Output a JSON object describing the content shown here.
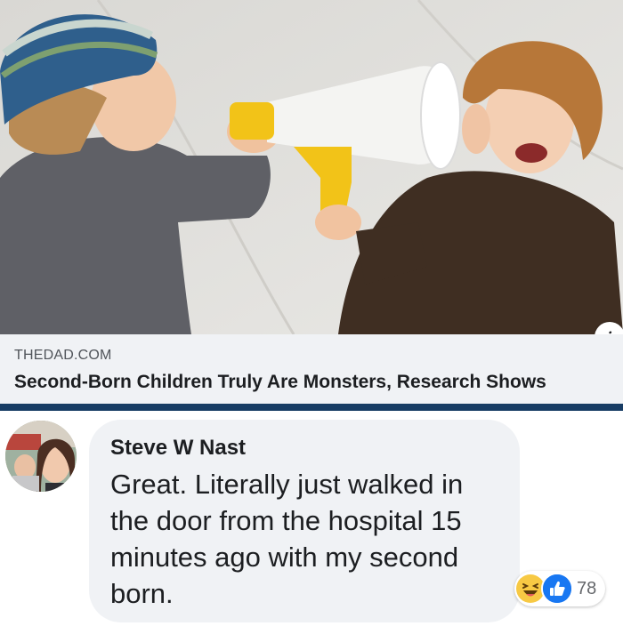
{
  "link_preview": {
    "image": "children-megaphone-photo",
    "info_icon": "info-icon",
    "info_glyph": "i",
    "domain": "THEDAD.COM",
    "headline": "Second-Born Children Truly Are Monsters, Research Shows",
    "accent_color": "#173c64"
  },
  "comment": {
    "avatar": "user-avatar",
    "author": "Steve W Nast",
    "text": "Great. Literally just walked in the door from the hospital 15 minutes ago with my second born.",
    "reactions": {
      "icons": [
        "haha-reaction-icon",
        "like-reaction-icon"
      ],
      "count": "78"
    }
  }
}
